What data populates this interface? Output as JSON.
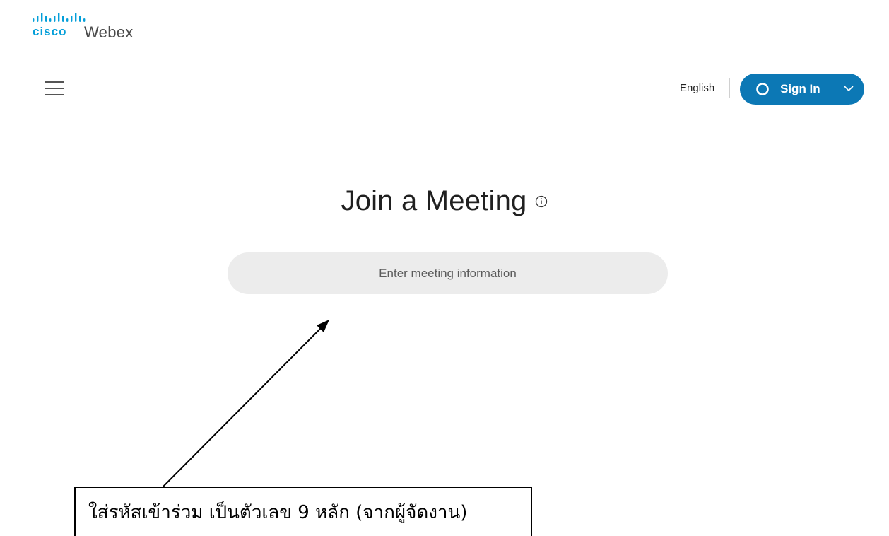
{
  "brand": {
    "logo_icon": "cisco-logo",
    "product_name": "Webex",
    "logo_color": "#049fd9"
  },
  "nav": {
    "menu_icon": "hamburger-menu-icon",
    "language": "English",
    "signin_label": "Sign In",
    "signin_color": "#0c78b5"
  },
  "main": {
    "title": "Join a Meeting",
    "info_icon": "info-icon",
    "input_value": "",
    "input_placeholder": "Enter meeting information"
  },
  "annotation": {
    "text": "ใส่รหัสเข้าร่วม เป็นตัวเลข 9 หลัก (จากผู้จัดงาน)"
  }
}
